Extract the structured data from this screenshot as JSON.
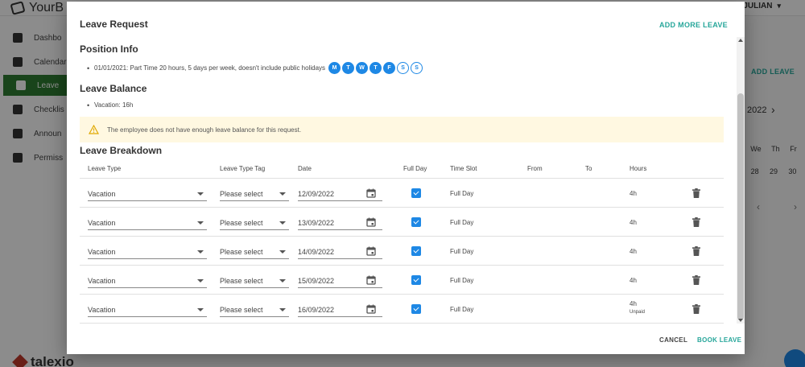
{
  "background": {
    "logo_text": "YourB",
    "user_name": "JULIAN",
    "sidebar_items": [
      {
        "label": "Dashbo",
        "icon": "dashboard-icon"
      },
      {
        "label": "Calendar",
        "icon": "calendar-icon"
      },
      {
        "label": "Leave",
        "icon": "list-icon"
      },
      {
        "label": "Checklis",
        "icon": "checklist-icon"
      },
      {
        "label": "Announ",
        "icon": "announcement-icon"
      },
      {
        "label": "Permiss",
        "icon": "shield-icon"
      }
    ],
    "add_leave": "ADD LEAVE",
    "year": "2022",
    "weekdays": [
      "We",
      "Th",
      "Fr"
    ],
    "dates": [
      "28",
      "29",
      "30"
    ],
    "brand": "talexio"
  },
  "modal": {
    "title": "Leave Request",
    "add_more_label": "ADD MORE LEAVE",
    "position_info": {
      "heading": "Position Info",
      "text": "01/01/2021: Part Time 20 hours, 5 days per week, doesn't include public holidays",
      "days": [
        {
          "letter": "M",
          "active": true
        },
        {
          "letter": "T",
          "active": true
        },
        {
          "letter": "W",
          "active": true
        },
        {
          "letter": "T",
          "active": true
        },
        {
          "letter": "F",
          "active": true
        },
        {
          "letter": "S",
          "active": false
        },
        {
          "letter": "S",
          "active": false
        }
      ]
    },
    "leave_balance": {
      "heading": "Leave Balance",
      "item": "Vacation: 16h"
    },
    "alert_text": "The employee does not have enough leave balance for this request.",
    "breakdown": {
      "heading": "Leave Breakdown",
      "columns": {
        "leave_type": "Leave Type",
        "tag": "Leave Type Tag",
        "date": "Date",
        "full_day": "Full Day",
        "time_slot": "Time Slot",
        "from": "From",
        "to": "To",
        "hours": "Hours"
      },
      "rows": [
        {
          "leave_type": "Vacation",
          "tag": "Please select",
          "date": "12/09/2022",
          "full_day": true,
          "time_slot": "Full Day",
          "hours": "4h",
          "note": ""
        },
        {
          "leave_type": "Vacation",
          "tag": "Please select",
          "date": "13/09/2022",
          "full_day": true,
          "time_slot": "Full Day",
          "hours": "4h",
          "note": ""
        },
        {
          "leave_type": "Vacation",
          "tag": "Please select",
          "date": "14/09/2022",
          "full_day": true,
          "time_slot": "Full Day",
          "hours": "4h",
          "note": ""
        },
        {
          "leave_type": "Vacation",
          "tag": "Please select",
          "date": "15/09/2022",
          "full_day": true,
          "time_slot": "Full Day",
          "hours": "4h",
          "note": ""
        },
        {
          "leave_type": "Vacation",
          "tag": "Please select",
          "date": "16/09/2022",
          "full_day": true,
          "time_slot": "Full Day",
          "hours": "4h",
          "note": "Unpaid"
        }
      ]
    },
    "cancel_label": "CANCEL",
    "book_label": "BOOK LEAVE",
    "colors": {
      "accent": "#26a69a",
      "primary": "#1e88e5",
      "alert_bg": "#fff8e1"
    }
  }
}
